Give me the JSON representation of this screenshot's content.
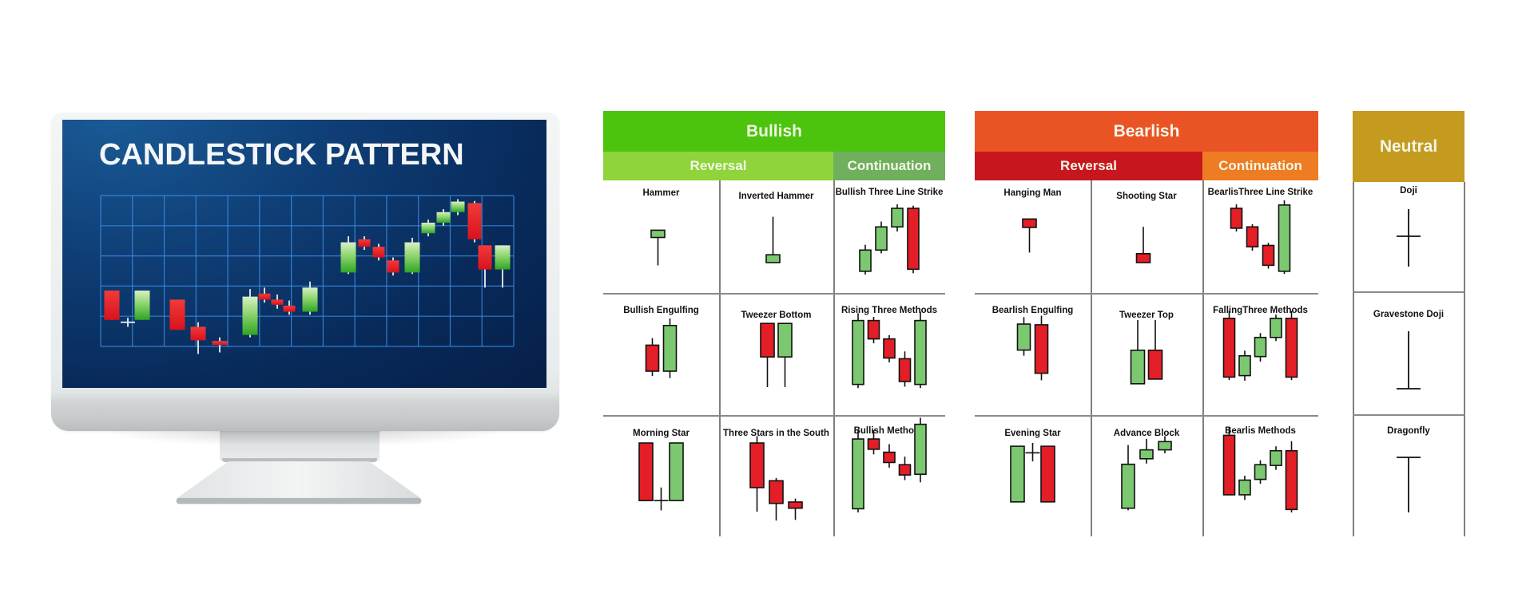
{
  "monitor": {
    "title": "CANDLESTICK PATTERN",
    "screen_chart": {
      "type": "candlestick",
      "grid": {
        "columns": 13,
        "rows": 5
      },
      "colors": {
        "bull": "#4fb83a",
        "bear": "#e61e25",
        "wick": "#f0f0f0",
        "grid": "#3b8be0"
      },
      "candles": [
        {
          "dir": "bear",
          "open": 0.88,
          "close": 1.85,
          "high": 1.85,
          "low": 0.88
        },
        {
          "dir": "doji",
          "open": 0.8,
          "close": 0.8,
          "high": 0.95,
          "low": 0.65
        },
        {
          "dir": "bull",
          "open": 0.88,
          "close": 1.85,
          "high": 1.85,
          "low": 0.88
        },
        {
          "dir": "bear",
          "open": 0.55,
          "close": 1.55,
          "high": 1.55,
          "low": 0.55
        },
        {
          "dir": "bear",
          "open": 0.2,
          "close": 0.65,
          "high": 0.8,
          "low": -0.25
        },
        {
          "dir": "bear",
          "open": 0.05,
          "close": 0.18,
          "high": 0.3,
          "low": -0.2
        },
        {
          "dir": "bull",
          "open": 0.38,
          "close": 1.65,
          "high": 1.9,
          "low": 0.3
        },
        {
          "dir": "bear",
          "open": 1.55,
          "close": 1.75,
          "high": 1.95,
          "low": 1.45
        },
        {
          "dir": "bear",
          "open": 1.38,
          "close": 1.55,
          "high": 1.72,
          "low": 1.25
        },
        {
          "dir": "bear",
          "open": 1.15,
          "close": 1.35,
          "high": 1.52,
          "low": 1.05
        },
        {
          "dir": "bull",
          "open": 1.15,
          "close": 1.95,
          "high": 2.15,
          "low": 1.05
        },
        {
          "dir": "bull",
          "open": 2.45,
          "close": 3.45,
          "high": 3.65,
          "low": 2.4
        },
        {
          "dir": "bear",
          "open": 3.3,
          "close": 3.55,
          "high": 3.65,
          "low": 3.2
        },
        {
          "dir": "bear",
          "open": 2.95,
          "close": 3.3,
          "high": 3.4,
          "low": 2.85
        },
        {
          "dir": "bear",
          "open": 2.45,
          "close": 2.85,
          "high": 2.95,
          "low": 2.35
        },
        {
          "dir": "bull",
          "open": 2.45,
          "close": 3.45,
          "high": 3.6,
          "low": 2.4
        },
        {
          "dir": "bull",
          "open": 3.75,
          "close": 4.1,
          "high": 4.2,
          "low": 3.65
        },
        {
          "dir": "bull",
          "open": 4.1,
          "close": 4.45,
          "high": 4.55,
          "low": 4.0
        },
        {
          "dir": "bull",
          "open": 4.45,
          "close": 4.8,
          "high": 4.88,
          "low": 4.35
        },
        {
          "dir": "bear",
          "open": 4.75,
          "close": 3.55,
          "high": 4.82,
          "low": 3.45
        },
        {
          "dir": "bear",
          "open": 3.35,
          "close": 2.55,
          "high": 3.35,
          "low": 1.95
        },
        {
          "dir": "bull",
          "open": 2.55,
          "close": 3.35,
          "high": 3.35,
          "low": 1.95
        }
      ]
    }
  },
  "colors": {
    "bull_fill": "#7cc870",
    "bear_fill": "#e41e26",
    "outline": "#111111",
    "bullish_header": "#4cc30c",
    "bullish_reversal": "#8fd43a",
    "bullish_continuation": "#6faf5e",
    "bearish_header": "#ea5425",
    "bearish_reversal": "#c8161e",
    "bearish_continuation": "#ee7c22",
    "neutral_header": "#c49a1f"
  },
  "groups": [
    {
      "id": "bullish",
      "title": "Bullish",
      "sub": {
        "reversal": "Reversal",
        "continuation": "Continuation"
      },
      "patterns": [
        {
          "name": "Hammer",
          "candles": [
            {
              "t": "bull",
              "o": 0.55,
              "c": 0.68,
              "h": 0.68,
              "l": 0.05
            }
          ]
        },
        {
          "name": "Inverted Hammer",
          "candles": [
            {
              "t": "bull",
              "o": 0.1,
              "c": 0.24,
              "h": 0.92,
              "l": 0.1
            }
          ]
        },
        {
          "name": "Bullish Three Line Strike",
          "candles": [
            {
              "t": "bull",
              "o": 0.05,
              "c": 0.37,
              "h": 0.45,
              "l": 0.0
            },
            {
              "t": "bull",
              "o": 0.37,
              "c": 0.72,
              "h": 0.8,
              "l": 0.32
            },
            {
              "t": "bull",
              "o": 0.72,
              "c": 1.0,
              "h": 1.06,
              "l": 0.65
            },
            {
              "t": "bear",
              "o": 1.0,
              "c": 0.08,
              "h": 1.04,
              "l": 0.02
            }
          ]
        },
        {
          "name": "Bullish Engulfing",
          "candles": [
            {
              "t": "bear",
              "o": 0.62,
              "c": 0.25,
              "h": 0.72,
              "l": 0.18
            },
            {
              "t": "bull",
              "o": 0.25,
              "c": 0.9,
              "h": 1.0,
              "l": 0.15
            }
          ]
        },
        {
          "name": "Tweezer Bottom",
          "candles": [
            {
              "t": "bear",
              "o": 0.95,
              "c": 0.45,
              "h": 0.95,
              "l": 0.0
            },
            {
              "t": "bull",
              "o": 0.45,
              "c": 0.95,
              "h": 0.95,
              "l": 0.0
            }
          ]
        },
        {
          "name": "Rising Three Methods",
          "candles": [
            {
              "t": "bull",
              "o": 0.08,
              "c": 0.95,
              "h": 1.05,
              "l": 0.03
            },
            {
              "t": "bear",
              "o": 0.95,
              "c": 0.7,
              "h": 1.0,
              "l": 0.64
            },
            {
              "t": "bear",
              "o": 0.7,
              "c": 0.44,
              "h": 0.75,
              "l": 0.38
            },
            {
              "t": "bear",
              "o": 0.43,
              "c": 0.12,
              "h": 0.53,
              "l": 0.05
            },
            {
              "t": "bull",
              "o": 0.08,
              "c": 0.95,
              "h": 1.07,
              "l": 0.03
            }
          ]
        },
        {
          "name": "Morning Star",
          "candles": [
            {
              "t": "bear",
              "o": 1.0,
              "c": 0.12,
              "h": 1.0,
              "l": 0.12
            },
            {
              "t": "doji",
              "o": 0.12,
              "c": 0.12,
              "h": 0.32,
              "l": -0.03
            },
            {
              "t": "bull",
              "o": 0.12,
              "c": 1.0,
              "h": 1.0,
              "l": 0.12
            }
          ]
        },
        {
          "name": "Three Stars in the South",
          "candles": [
            {
              "t": "bear",
              "o": 1.0,
              "c": 0.35,
              "h": 1.1,
              "l": 0.0
            },
            {
              "t": "bear",
              "o": 0.45,
              "c": 0.12,
              "h": 0.49,
              "l": -0.13
            },
            {
              "t": "bear",
              "o": 0.14,
              "c": 0.05,
              "h": 0.19,
              "l": -0.12
            }
          ]
        },
        {
          "name": "Bullish Methods",
          "candles": [
            {
              "t": "bull",
              "o": 0.05,
              "c": 1.0,
              "h": 1.12,
              "l": 0.0
            },
            {
              "t": "bear",
              "o": 1.0,
              "c": 0.86,
              "h": 1.12,
              "l": 0.79
            },
            {
              "t": "bear",
              "o": 0.82,
              "c": 0.68,
              "h": 0.93,
              "l": 0.61
            },
            {
              "t": "bear",
              "o": 0.65,
              "c": 0.51,
              "h": 0.76,
              "l": 0.44
            },
            {
              "t": "bull",
              "o": 0.52,
              "c": 1.2,
              "h": 1.29,
              "l": 0.41
            }
          ]
        }
      ]
    },
    {
      "id": "bearish",
      "title": "Bearlish",
      "sub": {
        "reversal": "Reversal",
        "continuation": "Continuation"
      },
      "patterns": [
        {
          "name": "Hanging Man",
          "candles": [
            {
              "t": "bear",
              "o": 0.88,
              "c": 0.73,
              "h": 0.88,
              "l": 0.28
            }
          ]
        },
        {
          "name": "Shooting Star",
          "candles": [
            {
              "t": "bear",
              "o": 0.26,
              "c": 0.1,
              "h": 0.74,
              "l": 0.1
            }
          ]
        },
        {
          "name": "BearlisThree Line Strike",
          "candles": [
            {
              "t": "bear",
              "o": 1.0,
              "c": 0.7,
              "h": 1.06,
              "l": 0.65
            },
            {
              "t": "bear",
              "o": 0.72,
              "c": 0.42,
              "h": 0.76,
              "l": 0.36
            },
            {
              "t": "bear",
              "o": 0.44,
              "c": 0.14,
              "h": 0.48,
              "l": 0.09
            },
            {
              "t": "bull",
              "o": 0.05,
              "c": 1.05,
              "h": 1.12,
              "l": 0.01
            }
          ]
        },
        {
          "name": "Bearlish Engulfing",
          "candles": [
            {
              "t": "bull",
              "o": 0.55,
              "c": 0.92,
              "h": 1.02,
              "l": 0.47
            },
            {
              "t": "bear",
              "o": 0.91,
              "c": 0.22,
              "h": 1.04,
              "l": 0.12
            }
          ]
        },
        {
          "name": "Tweezer Top",
          "candles": [
            {
              "t": "bull",
              "o": 0.05,
              "c": 0.55,
              "h": 1.0,
              "l": 0.05
            },
            {
              "t": "bear",
              "o": 0.55,
              "c": 0.12,
              "h": 1.0,
              "l": 0.12
            }
          ]
        },
        {
          "name": "FallingThree Methods",
          "candles": [
            {
              "t": "bear",
              "o": 0.98,
              "c": 0.18,
              "h": 1.08,
              "l": 0.14
            },
            {
              "t": "bull",
              "o": 0.2,
              "c": 0.47,
              "h": 0.54,
              "l": 0.13
            },
            {
              "t": "bull",
              "o": 0.46,
              "c": 0.72,
              "h": 0.78,
              "l": 0.39
            },
            {
              "t": "bull",
              "o": 0.72,
              "c": 0.98,
              "h": 1.03,
              "l": 0.67
            },
            {
              "t": "bear",
              "o": 0.98,
              "c": 0.18,
              "h": 1.08,
              "l": 0.14
            }
          ]
        },
        {
          "name": "Evening Star",
          "candles": [
            {
              "t": "bull",
              "o": 0.1,
              "c": 0.95,
              "h": 0.95,
              "l": 0.1
            },
            {
              "t": "doji",
              "o": 0.85,
              "c": 0.85,
              "h": 1.0,
              "l": 0.72
            },
            {
              "t": "bear",
              "o": 0.95,
              "c": 0.1,
              "h": 0.95,
              "l": 0.1
            }
          ]
        },
        {
          "name": "Advance Block",
          "candles": [
            {
              "t": "bull",
              "o": 0.05,
              "c": 0.69,
              "h": 0.97,
              "l": 0.02
            },
            {
              "t": "bull",
              "o": 0.77,
              "c": 0.9,
              "h": 1.06,
              "l": 0.7
            },
            {
              "t": "bull",
              "o": 0.9,
              "c": 1.02,
              "h": 1.1,
              "l": 0.85
            }
          ]
        },
        {
          "name": "Bearlis Methods",
          "candles": [
            {
              "t": "bear",
              "o": 1.05,
              "c": 0.24,
              "h": 1.16,
              "l": 0.24
            },
            {
              "t": "bull",
              "o": 0.24,
              "c": 0.44,
              "h": 0.5,
              "l": 0.17
            },
            {
              "t": "bull",
              "o": 0.45,
              "c": 0.65,
              "h": 0.71,
              "l": 0.39
            },
            {
              "t": "bull",
              "o": 0.64,
              "c": 0.84,
              "h": 0.9,
              "l": 0.58
            },
            {
              "t": "bear",
              "o": 0.84,
              "c": 0.04,
              "h": 0.97,
              "l": 0.0
            }
          ]
        }
      ]
    },
    {
      "id": "neutral",
      "title": "Neutral",
      "patterns": [
        {
          "name": "Doji",
          "kind": "doji"
        },
        {
          "name": "Gravestone Doji",
          "kind": "gravestone"
        },
        {
          "name": "Dragonfly",
          "kind": "dragonfly"
        }
      ]
    }
  ]
}
